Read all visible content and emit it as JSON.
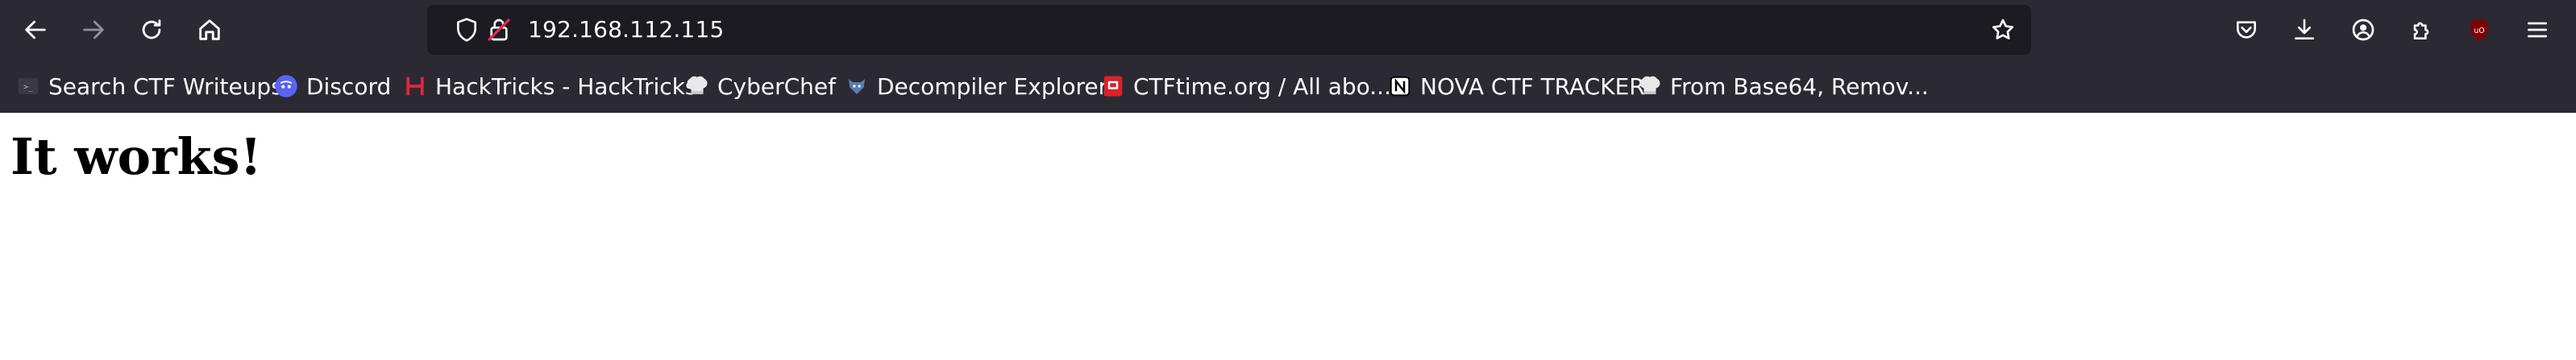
{
  "toolbar": {
    "url": "192.168.112.115"
  },
  "bookmarks": [
    {
      "label": "Search CTF Writeups",
      "icon": "ctf-writeups-icon"
    },
    {
      "label": "Discord",
      "icon": "discord-icon"
    },
    {
      "label": "HackTricks - HackTricks",
      "icon": "hacktricks-icon"
    },
    {
      "label": "CyberChef",
      "icon": "cyberchef-icon"
    },
    {
      "label": "Decompiler Explorer",
      "icon": "dogbolt-icon"
    },
    {
      "label": "CTFtime.org / All abo...",
      "icon": "ctftime-icon"
    },
    {
      "label": "NOVA CTF TRACKER",
      "icon": "notion-icon"
    },
    {
      "label": "From Base64, Remov...",
      "icon": "cyberchef-icon"
    }
  ],
  "page": {
    "heading": "It works!"
  },
  "colors": {
    "toolbar_bg": "#2b2a33",
    "urlbar_bg": "#1c1b22",
    "text": "#fbfbfe",
    "ublock_red": "#800000",
    "discord_blue": "#5865f2",
    "hacktricks_red": "#e0263c",
    "ctftime_red": "#d92228"
  }
}
